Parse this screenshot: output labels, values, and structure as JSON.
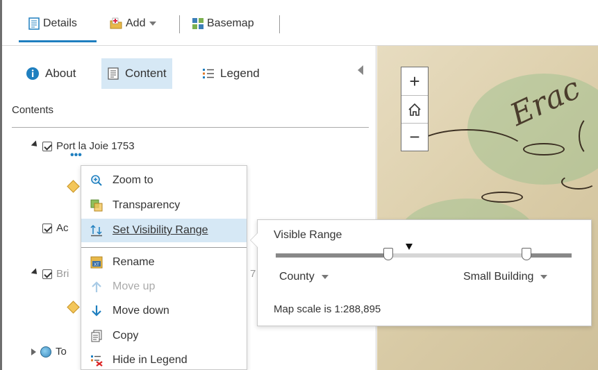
{
  "toolbar": {
    "details_label": "Details",
    "add_label": "Add",
    "basemap_label": "Basemap"
  },
  "panel": {
    "tabs": [
      {
        "label": "About"
      },
      {
        "label": "Content"
      },
      {
        "label": "Legend"
      }
    ],
    "contents_title": "Contents",
    "layers": [
      {
        "name": "Port la Joie 1753"
      },
      {
        "name": "Ac"
      },
      {
        "name": "Bri"
      },
      {
        "name": "To"
      }
    ],
    "layer_more_indicator": "•••",
    "bri_tail": "7"
  },
  "context_menu": {
    "items": [
      {
        "label": "Zoom to",
        "icon": "zoom-to-icon"
      },
      {
        "label": "Transparency",
        "icon": "transparency-icon"
      },
      {
        "label": "Set Visibility Range",
        "icon": "visibility-range-icon"
      },
      {
        "label": "Rename",
        "icon": "rename-icon"
      },
      {
        "label": "Move up",
        "icon": "arrow-up-icon"
      },
      {
        "label": "Move down",
        "icon": "arrow-down-icon"
      },
      {
        "label": "Copy",
        "icon": "copy-icon"
      },
      {
        "label": "Hide in Legend",
        "icon": "hide-legend-icon"
      }
    ]
  },
  "map": {
    "zoom_in": "+",
    "zoom_out": "−",
    "map_text": "Erac"
  },
  "visibility_popover": {
    "title": "Visible Range",
    "min_scale": "County",
    "max_scale": "Small Building",
    "scale_text": "Map scale is 1:288,895"
  },
  "colors": {
    "accent": "#1f7fbf",
    "highlight": "#d6e8f5"
  }
}
